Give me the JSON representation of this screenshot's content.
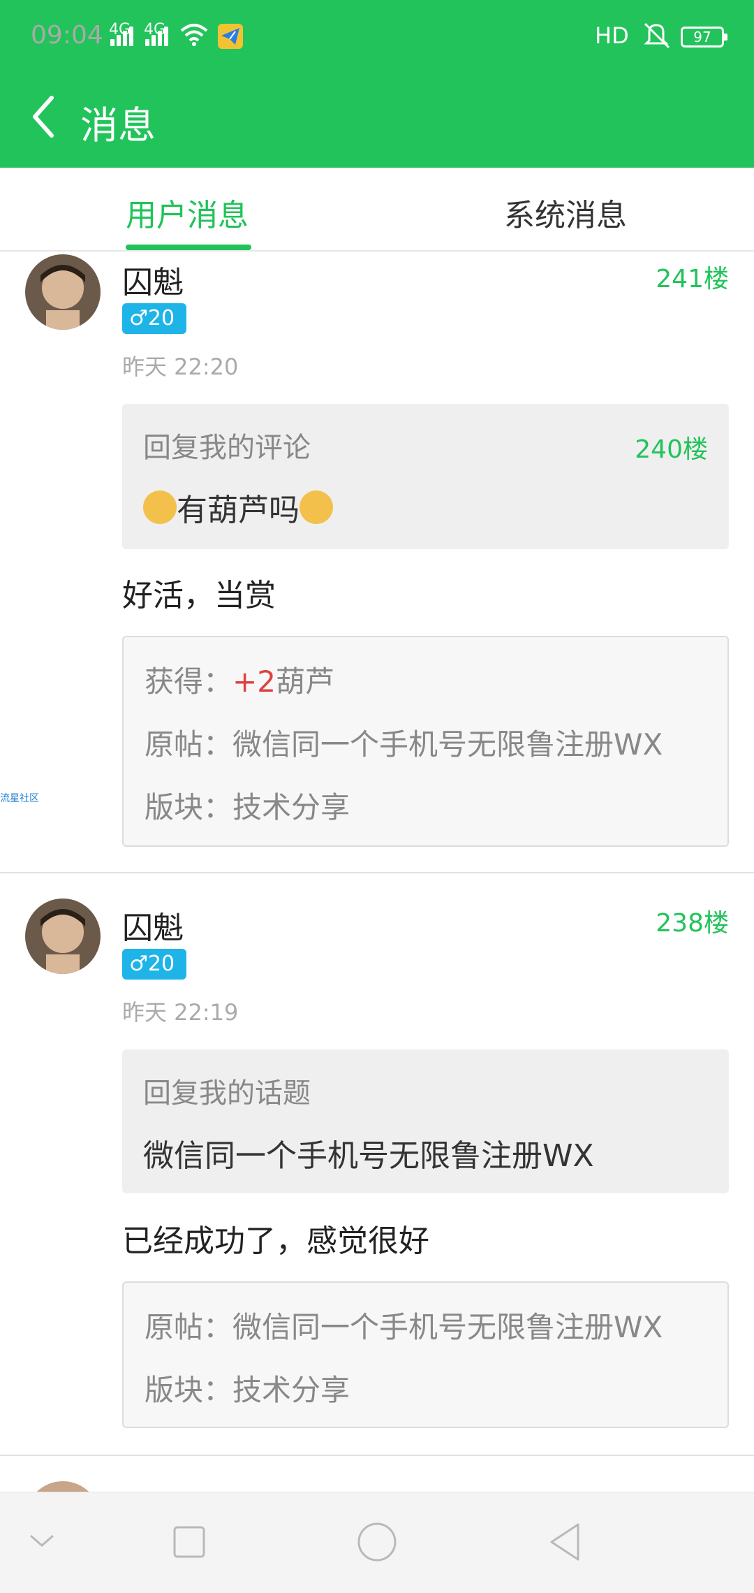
{
  "status_bar": {
    "time": "09:04",
    "net1": "4G",
    "net2": "4G",
    "hd": "HD",
    "battery": "97"
  },
  "header": {
    "title": "消息"
  },
  "tabs": [
    {
      "label": "用户消息",
      "active": true
    },
    {
      "label": "系统消息",
      "active": false
    }
  ],
  "side_label": "流星社区",
  "messages": [
    {
      "user": "囚魁",
      "badge": "♂20",
      "floor": "241楼",
      "time": "昨天 22:20",
      "quote_header": "回复我的评论",
      "quote_floor": "240楼",
      "quote_text": "有葫芦吗",
      "reply": "好活，当赏",
      "reward_label": "获得：",
      "reward_value": "+2",
      "reward_unit": "葫芦",
      "origin": "原帖：微信同一个手机号无限鲁注册WX",
      "section": "版块：技术分享"
    },
    {
      "user": "囚魁",
      "badge": "♂20",
      "floor": "238楼",
      "time": "昨天 22:19",
      "quote_header": "回复我的话题",
      "quote_text": "微信同一个手机号无限鲁注册WX",
      "reply": "已经成功了，感觉很好",
      "origin": "原帖：微信同一个手机号无限鲁注册WX",
      "section": "版块：技术分享"
    }
  ],
  "colors": {
    "brand": "#21c35a",
    "badge": "#1fb4e8",
    "highlight": "#e04040"
  }
}
